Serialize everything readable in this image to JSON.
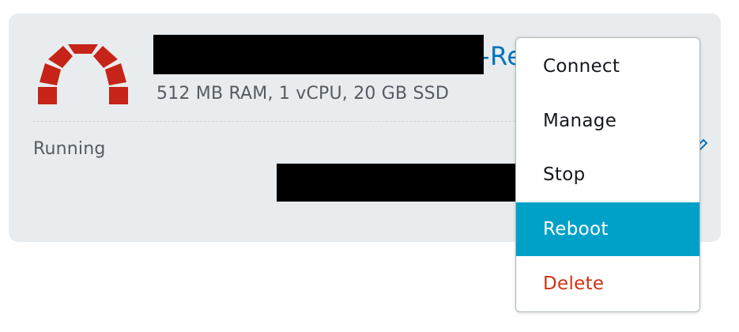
{
  "instance": {
    "name_visible_suffix": "-Re",
    "specs": "512 MB RAM, 1 vCPU, 20 GB SSD",
    "status": "Running",
    "logo_icon": "redis-arch-logo-icon",
    "logo_color": "#c62418"
  },
  "menu": {
    "items": [
      {
        "label": "Connect"
      },
      {
        "label": "Manage"
      },
      {
        "label": "Stop"
      },
      {
        "label": "Reboot"
      },
      {
        "label": "Delete"
      }
    ],
    "highlight_color": "#00a1c9",
    "danger_color": "#d13212"
  },
  "colors": {
    "card_bg": "#e9ecee",
    "link": "#0073bb",
    "muted_text": "#545b64"
  }
}
